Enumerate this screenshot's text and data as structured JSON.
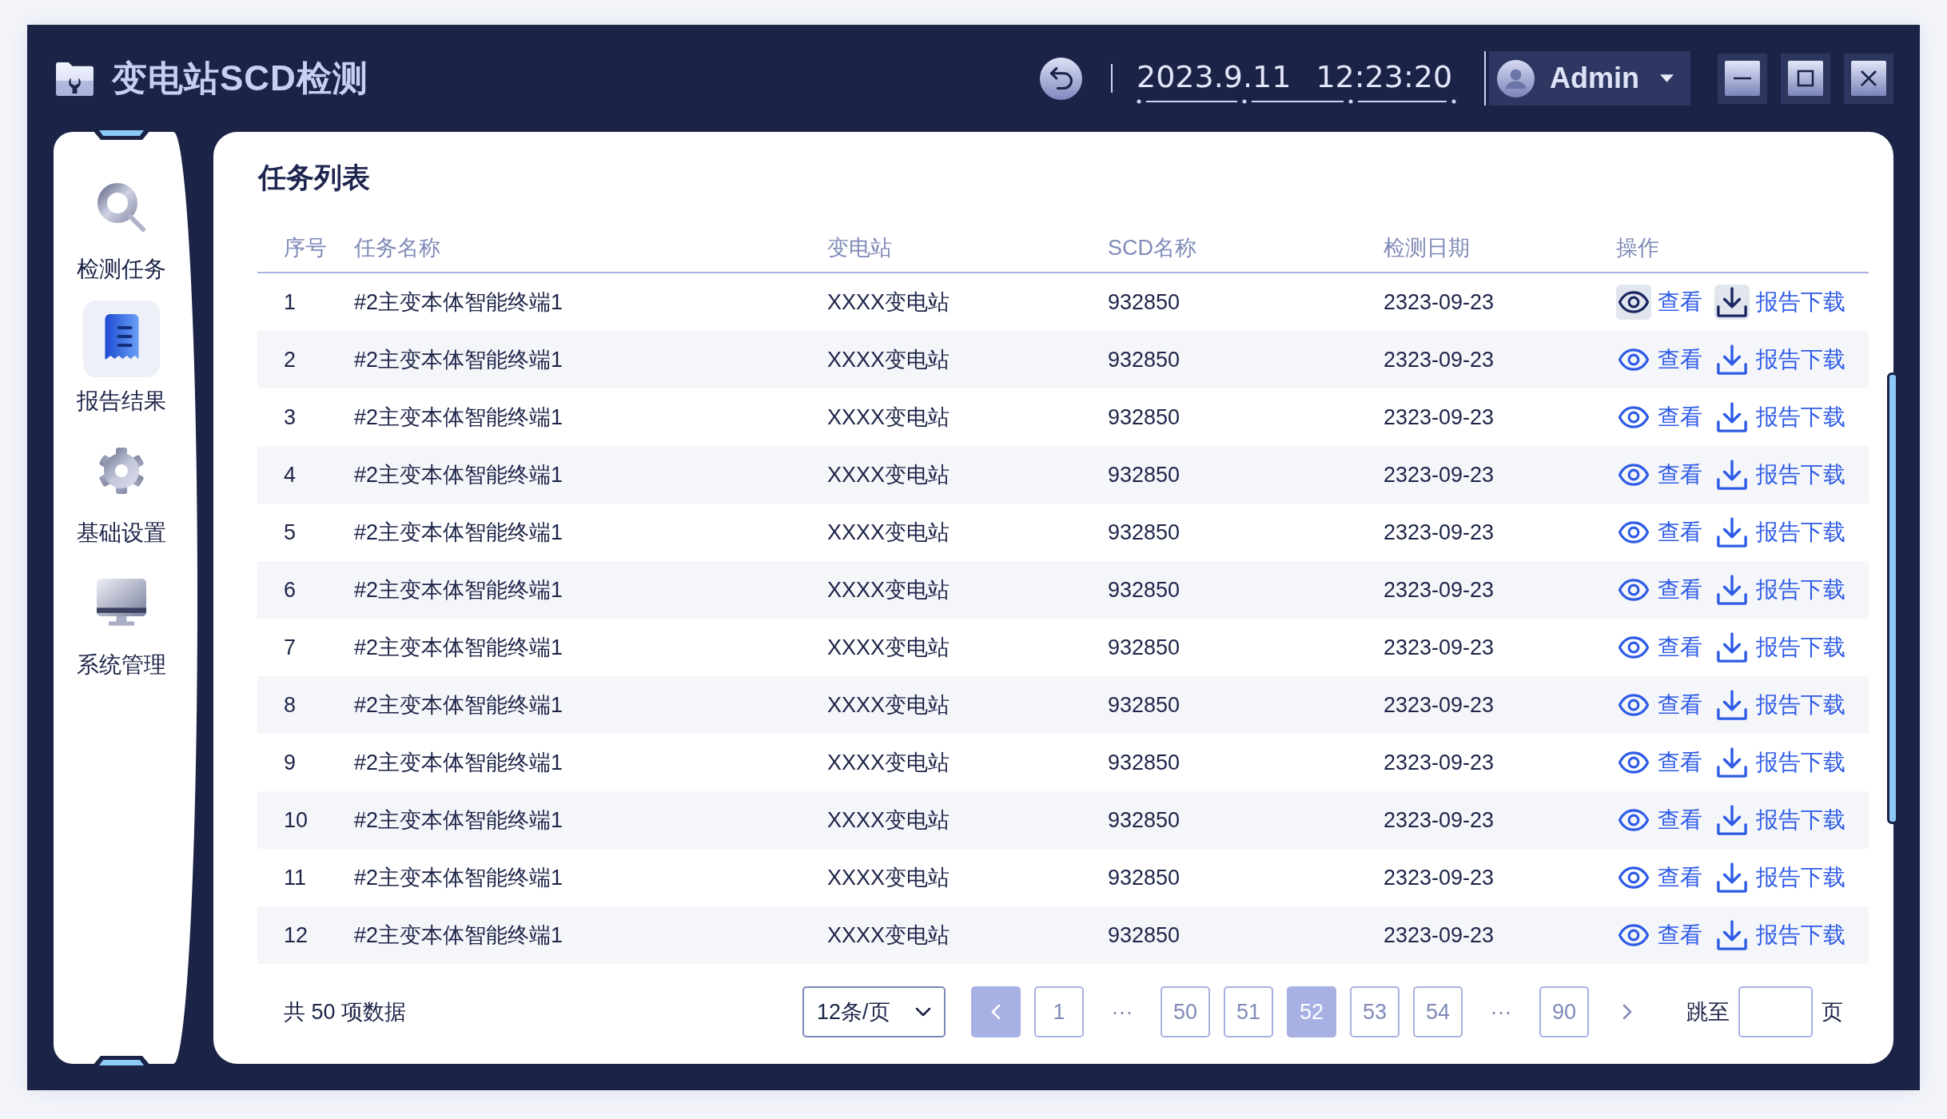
{
  "app": {
    "title": "变电站SCD检测"
  },
  "header": {
    "date": "2023.9.11",
    "time": "12:23:20",
    "user": {
      "name": "Admin"
    }
  },
  "sidebar": {
    "items": [
      {
        "label": "检测任务",
        "selected": false
      },
      {
        "label": "报告结果",
        "selected": true
      },
      {
        "label": "基础设置",
        "selected": false
      },
      {
        "label": "系统管理",
        "selected": false
      }
    ]
  },
  "panel": {
    "title": "任务列表"
  },
  "table": {
    "columns": [
      "序号",
      "任务名称",
      "变电站",
      "SCD名称",
      "检测日期",
      "操作"
    ],
    "rows": [
      {
        "index": "1",
        "task_name": "#2主变本体智能终端1",
        "substation": "XXXX变电站",
        "scd_name": "932850",
        "date": "2323-09-23",
        "hovered": true,
        "actions": [
          {
            "kind": "view",
            "label": "查看"
          },
          {
            "kind": "download",
            "label": "报告下载"
          }
        ]
      },
      {
        "index": "2",
        "task_name": "#2主变本体智能终端1",
        "substation": "XXXX变电站",
        "scd_name": "932850",
        "date": "2323-09-23",
        "hovered": false,
        "actions": [
          {
            "kind": "view",
            "label": "查看"
          },
          {
            "kind": "download",
            "label": "报告下载"
          }
        ]
      },
      {
        "index": "3",
        "task_name": "#2主变本体智能终端1",
        "substation": "XXXX变电站",
        "scd_name": "932850",
        "date": "2323-09-23",
        "hovered": false,
        "actions": [
          {
            "kind": "view",
            "label": "查看"
          },
          {
            "kind": "download",
            "label": "报告下载"
          }
        ]
      },
      {
        "index": "4",
        "task_name": "#2主变本体智能终端1",
        "substation": "XXXX变电站",
        "scd_name": "932850",
        "date": "2323-09-23",
        "hovered": false,
        "actions": [
          {
            "kind": "view",
            "label": "查看"
          },
          {
            "kind": "download",
            "label": "报告下载"
          }
        ]
      },
      {
        "index": "5",
        "task_name": "#2主变本体智能终端1",
        "substation": "XXXX变电站",
        "scd_name": "932850",
        "date": "2323-09-23",
        "hovered": false,
        "actions": [
          {
            "kind": "view",
            "label": "查看"
          },
          {
            "kind": "download",
            "label": "报告下载"
          }
        ]
      },
      {
        "index": "6",
        "task_name": "#2主变本体智能终端1",
        "substation": "XXXX变电站",
        "scd_name": "932850",
        "date": "2323-09-23",
        "hovered": false,
        "actions": [
          {
            "kind": "view",
            "label": "查看"
          },
          {
            "kind": "download",
            "label": "报告下载"
          }
        ]
      },
      {
        "index": "7",
        "task_name": "#2主变本体智能终端1",
        "substation": "XXXX变电站",
        "scd_name": "932850",
        "date": "2323-09-23",
        "hovered": false,
        "actions": [
          {
            "kind": "view",
            "label": "查看"
          },
          {
            "kind": "download",
            "label": "报告下载"
          }
        ]
      },
      {
        "index": "8",
        "task_name": "#2主变本体智能终端1",
        "substation": "XXXX变电站",
        "scd_name": "932850",
        "date": "2323-09-23",
        "hovered": false,
        "actions": [
          {
            "kind": "view",
            "label": "查看"
          },
          {
            "kind": "download",
            "label": "报告下载"
          }
        ]
      },
      {
        "index": "9",
        "task_name": "#2主变本体智能终端1",
        "substation": "XXXX变电站",
        "scd_name": "932850",
        "date": "2323-09-23",
        "hovered": false,
        "actions": [
          {
            "kind": "view",
            "label": "查看"
          },
          {
            "kind": "download",
            "label": "报告下载"
          }
        ]
      },
      {
        "index": "10",
        "task_name": "#2主变本体智能终端1",
        "substation": "XXXX变电站",
        "scd_name": "932850",
        "date": "2323-09-23",
        "hovered": false,
        "actions": [
          {
            "kind": "view",
            "label": "查看"
          },
          {
            "kind": "download",
            "label": "报告下载"
          }
        ]
      },
      {
        "index": "11",
        "task_name": "#2主变本体智能终端1",
        "substation": "XXXX变电站",
        "scd_name": "932850",
        "date": "2323-09-23",
        "hovered": false,
        "actions": [
          {
            "kind": "view",
            "label": "查看"
          },
          {
            "kind": "download",
            "label": "报告下载"
          }
        ]
      },
      {
        "index": "12",
        "task_name": "#2主变本体智能终端1",
        "substation": "XXXX变电站",
        "scd_name": "932850",
        "date": "2323-09-23",
        "hovered": false,
        "actions": [
          {
            "kind": "view",
            "label": "查看"
          },
          {
            "kind": "download",
            "label": "报告下载"
          }
        ]
      }
    ]
  },
  "pagination": {
    "summary": "共 50 项数据",
    "page_size": "12条/页",
    "previous": {
      "highlighted": true
    },
    "pages": [
      {
        "kind": "page",
        "label": "1",
        "selected": false
      },
      {
        "kind": "ellipsis",
        "label": "···",
        "selected": false
      },
      {
        "kind": "page",
        "label": "50",
        "selected": false
      },
      {
        "kind": "page",
        "label": "51",
        "selected": false
      },
      {
        "kind": "page",
        "label": "52",
        "selected": true
      },
      {
        "kind": "page",
        "label": "53",
        "selected": false
      },
      {
        "kind": "page",
        "label": "54",
        "selected": false
      },
      {
        "kind": "ellipsis",
        "label": "···",
        "selected": false
      },
      {
        "kind": "page",
        "label": "90",
        "selected": false
      }
    ],
    "next": {
      "highlighted": false
    },
    "jump": {
      "label": "跳至",
      "suffix": "页"
    }
  }
}
